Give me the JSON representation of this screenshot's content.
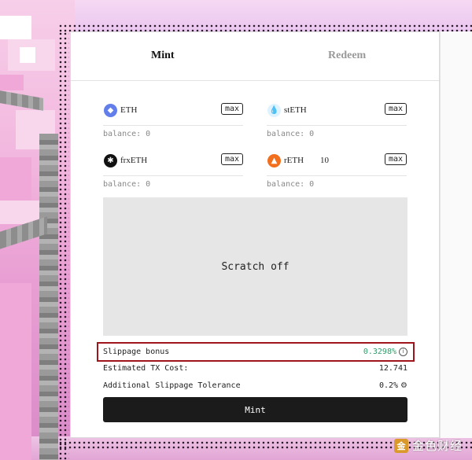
{
  "tabs": [
    {
      "label": "Mint",
      "active": true
    },
    {
      "label": "Redeem",
      "active": false
    }
  ],
  "tokens": [
    {
      "name": "ETH",
      "icon": "eth-icon",
      "color": "#627eea",
      "amount": "",
      "max_label": "max",
      "balance": "balance: 0"
    },
    {
      "name": "stETH",
      "icon": "steth-icon",
      "color": "#00a3ff",
      "amount": "",
      "max_label": "max",
      "balance": "balance: 0"
    },
    {
      "name": "frxETH",
      "icon": "frxeth-icon",
      "color": "#111111",
      "amount": "",
      "max_label": "max",
      "balance": "balance: 0"
    },
    {
      "name": "rETH",
      "icon": "reth-icon",
      "color": "#f26f1e",
      "amount": "10",
      "max_label": "max",
      "balance": "balance: 0"
    }
  ],
  "scratch_label": "Scratch off",
  "info": {
    "slippage_bonus_label": "Slippage bonus",
    "slippage_bonus_value": "0.3298%",
    "tx_cost_label": "Estimated TX Cost:",
    "tx_cost_value": "12.741",
    "tolerance_label": "Additional Slippage Tolerance",
    "tolerance_value": "0.2%"
  },
  "mint_button_label": "Mint",
  "watermark": {
    "logo": "金",
    "text": "金色财经"
  },
  "colors": {
    "accent_green": "#2f9c6a",
    "highlight_red": "#a0151b",
    "button_dark": "#1b1b1b"
  }
}
